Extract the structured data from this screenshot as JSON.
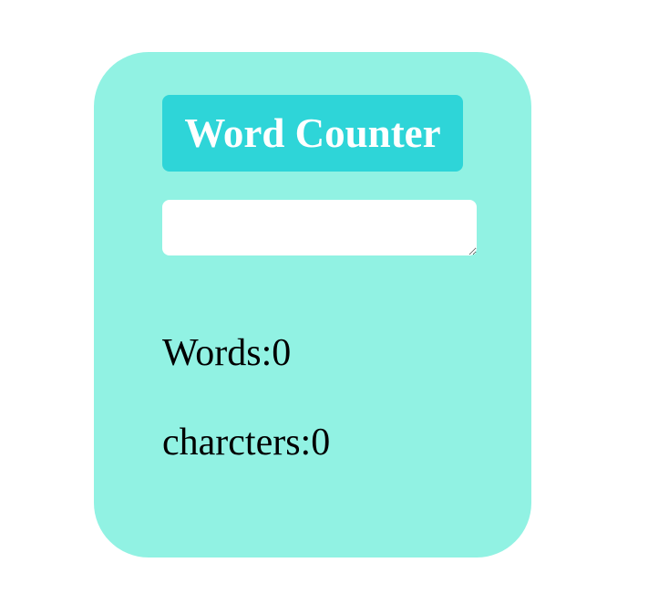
{
  "app": {
    "title": "Word Counter"
  },
  "input": {
    "value": ""
  },
  "stats": {
    "words_label": "Words:",
    "words_count": "0",
    "chars_label": "charcters:",
    "chars_count": "0"
  },
  "colors": {
    "card_background": "#91f2e3",
    "title_background": "#2ed5d8",
    "title_text": "#ffffff",
    "input_background": "#ffffff",
    "text": "#000000"
  }
}
